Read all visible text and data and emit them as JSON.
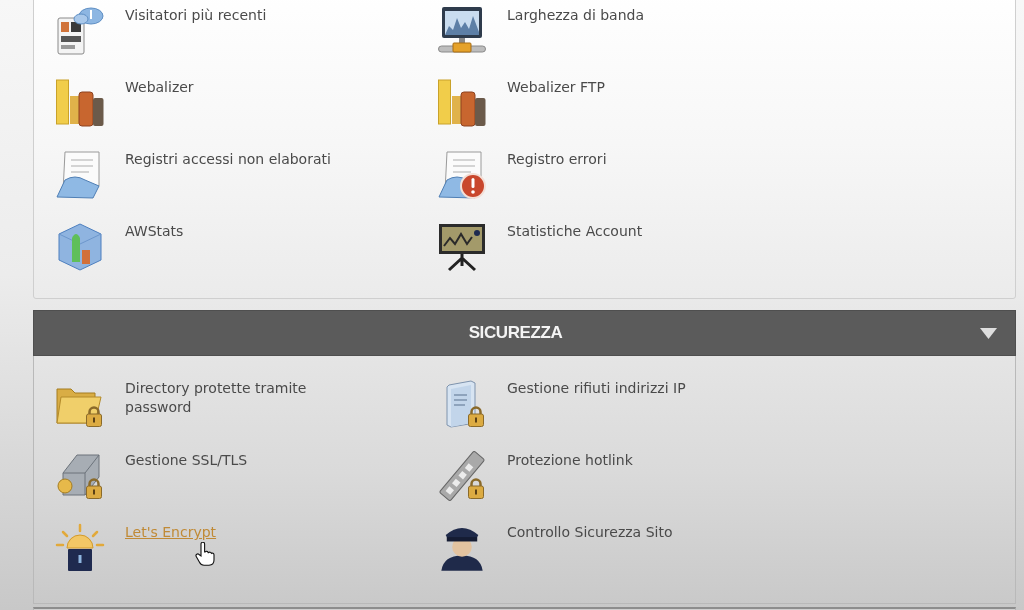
{
  "sections": [
    {
      "items": [
        {
          "label": "Visitatori più recenti",
          "hovered": false
        },
        {
          "label": "Larghezza di banda",
          "hovered": false
        },
        {
          "label": "Webalizer",
          "hovered": false
        },
        {
          "label": "Webalizer FTP",
          "hovered": false
        },
        {
          "label": "Registri accessi non elaborati",
          "hovered": false
        },
        {
          "label": "Registro errori",
          "hovered": false
        },
        {
          "label": "AWStats",
          "hovered": false
        },
        {
          "label": "Statistiche Account",
          "hovered": false
        }
      ]
    },
    {
      "title": "SICUREZZA",
      "expanded": true,
      "items": [
        {
          "label": "Directory protette tramite password",
          "hovered": false
        },
        {
          "label": "Gestione rifiuti indirizzi IP",
          "hovered": false
        },
        {
          "label": "Gestione SSL/TLS",
          "hovered": false
        },
        {
          "label": "Protezione hotlink",
          "hovered": false
        },
        {
          "label": "Let's Encrypt",
          "hovered": true
        },
        {
          "label": "Controllo Sicurezza Sito",
          "hovered": false
        }
      ]
    }
  ]
}
